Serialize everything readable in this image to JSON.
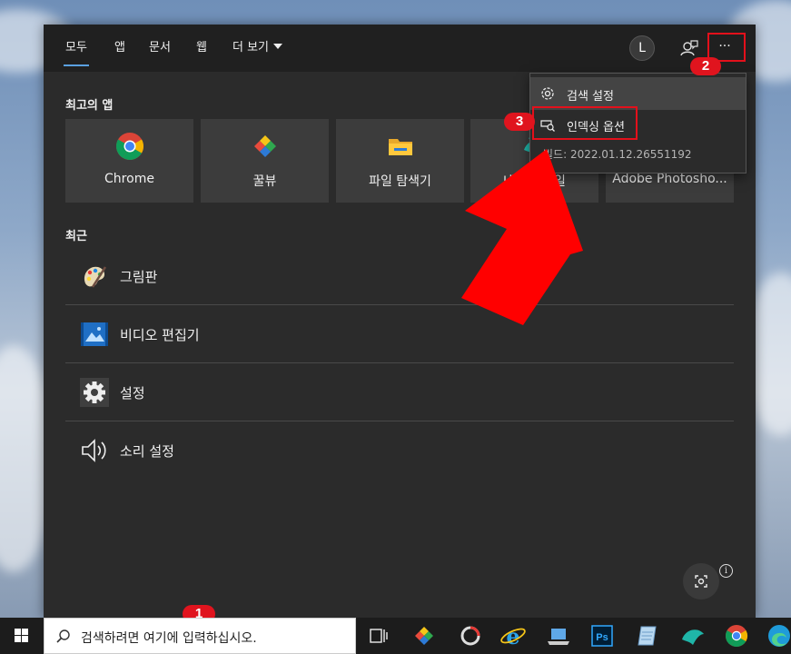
{
  "tabs": [
    {
      "label": "모두",
      "active": true
    },
    {
      "label": "앱"
    },
    {
      "label": "문서"
    },
    {
      "label": "웹"
    },
    {
      "label": "더 보기"
    }
  ],
  "header": {
    "avatar_letter": "L",
    "more_label": "···"
  },
  "sections": {
    "top_apps": "최고의 앱",
    "recent": "최근"
  },
  "top_apps": [
    {
      "label": "Chrome",
      "icon": "chrome-icon"
    },
    {
      "label": "꿀뷰",
      "icon": "honeyview-icon"
    },
    {
      "label": "파일 탐색기",
      "icon": "folder-icon"
    },
    {
      "label": "네이버 웨일",
      "icon": "whale-icon"
    },
    {
      "label": "Adobe Photosho...",
      "icon": "photoshop-icon"
    }
  ],
  "recent": [
    {
      "label": "그림판",
      "icon": "paint-icon"
    },
    {
      "label": "비디오 편집기",
      "icon": "video-editor-icon"
    },
    {
      "label": "설정",
      "icon": "gear-icon"
    },
    {
      "label": "소리 설정",
      "icon": "speaker-icon"
    }
  ],
  "menu": {
    "items": [
      {
        "label": "검색 설정",
        "icon": "gear-icon"
      },
      {
        "label": "인덱싱 옵션",
        "icon": "indexing-icon"
      }
    ],
    "build": "빌드: 2022.01.12.26551192"
  },
  "annotations": {
    "badge1": "1",
    "badge2": "2",
    "badge3": "3"
  },
  "taskbar": {
    "search_placeholder": "검색하려면 여기에 입력하십시오."
  },
  "colors": {
    "panel_bg": "#2b2b2b",
    "tile_bg": "#3c3c3c",
    "highlight_red": "#e3101b",
    "accent": "#5aa0e0"
  }
}
